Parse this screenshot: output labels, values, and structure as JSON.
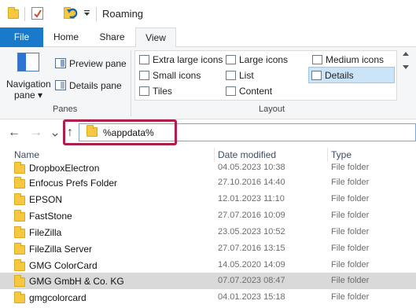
{
  "window": {
    "title": "Roaming"
  },
  "ribbon_tabs": {
    "file": "File",
    "home": "Home",
    "share": "Share",
    "view": "View"
  },
  "panes": {
    "navigation_pane": "Navigation pane ▾",
    "preview_pane": "Preview pane",
    "details_pane": "Details pane",
    "group_label": "Panes"
  },
  "layout": {
    "group_label": "Layout",
    "items": [
      "Extra large icons",
      "Large icons",
      "Medium icons",
      "Small icons",
      "List",
      "Details",
      "Tiles",
      "Content"
    ],
    "selected": "Details"
  },
  "address": {
    "value": "%appdata%"
  },
  "columns": {
    "name": "Name",
    "date": "Date modified",
    "type": "Type"
  },
  "files": [
    {
      "name": "DropboxElectron",
      "date": "04.05.2023 10:38",
      "type": "File folder"
    },
    {
      "name": "Enfocus Prefs Folder",
      "date": "27.10.2016 14:40",
      "type": "File folder"
    },
    {
      "name": "EPSON",
      "date": "12.01.2023 11:10",
      "type": "File folder"
    },
    {
      "name": "FastStone",
      "date": "27.07.2016 10:09",
      "type": "File folder"
    },
    {
      "name": "FileZilla",
      "date": "23.05.2023 10:52",
      "type": "File folder"
    },
    {
      "name": "FileZilla Server",
      "date": "27.07.2016 13:15",
      "type": "File folder"
    },
    {
      "name": "GMG ColorCard",
      "date": "14.05.2020 14:09",
      "type": "File folder"
    },
    {
      "name": "GMG GmbH & Co. KG",
      "date": "07.07.2023 08:47",
      "type": "File folder",
      "selected": true
    },
    {
      "name": "gmgcolorcard",
      "date": "04.01.2023 15:18",
      "type": "File folder"
    }
  ],
  "colors": {
    "file_tab": "#1979ca",
    "highlight": "#b01e4a",
    "selected_row": "#d9d9d9",
    "folder": "#f5c842"
  }
}
